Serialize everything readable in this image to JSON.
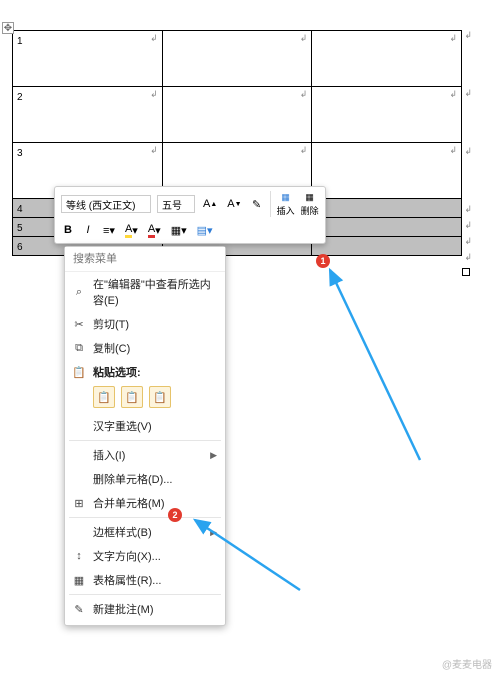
{
  "table": {
    "rows": [
      {
        "num": "1",
        "tall": true,
        "selected": false
      },
      {
        "num": "2",
        "tall": true,
        "selected": false
      },
      {
        "num": "3",
        "tall": true,
        "selected": false
      },
      {
        "num": "4",
        "tall": false,
        "selected": true
      },
      {
        "num": "5",
        "tall": false,
        "selected": true
      },
      {
        "num": "6",
        "tall": false,
        "selected": true
      }
    ]
  },
  "mini_toolbar": {
    "font_name": "等线 (西文正文)",
    "font_size": "五号",
    "grow": "A",
    "shrink": "A",
    "format_painter": "✎",
    "bold": "B",
    "italic": "I",
    "insert_label": "插入",
    "delete_label": "删除"
  },
  "context_menu": {
    "search_placeholder": "搜索菜单",
    "items": [
      {
        "icon": "⌕",
        "label": "在\"编辑器\"中查看所选内容(E)"
      },
      {
        "icon": "✂",
        "label": "剪切(T)"
      },
      {
        "icon": "⧉",
        "label": "复制(C)"
      },
      {
        "icon": "📋",
        "label": "粘贴选项:",
        "paste_header": true
      },
      {
        "paste_options": true
      },
      {
        "icon": "",
        "label": "汉字重选(V)"
      },
      {
        "sep": true
      },
      {
        "icon": "",
        "label": "插入(I)",
        "submenu": true
      },
      {
        "icon": "",
        "label": "删除单元格(D)..."
      },
      {
        "icon": "⊞",
        "label": "合并单元格(M)"
      },
      {
        "sep": true
      },
      {
        "icon": "",
        "label": "边框样式(B)",
        "submenu": true
      },
      {
        "icon": "↕",
        "label": "文字方向(X)..."
      },
      {
        "icon": "▦",
        "label": "表格属性(R)...",
        "highlight": true
      },
      {
        "sep": true
      },
      {
        "icon": "✎",
        "label": "新建批注(M)"
      }
    ]
  },
  "badges": {
    "one": "1",
    "two": "2"
  },
  "watermark": "@麦麦电器"
}
